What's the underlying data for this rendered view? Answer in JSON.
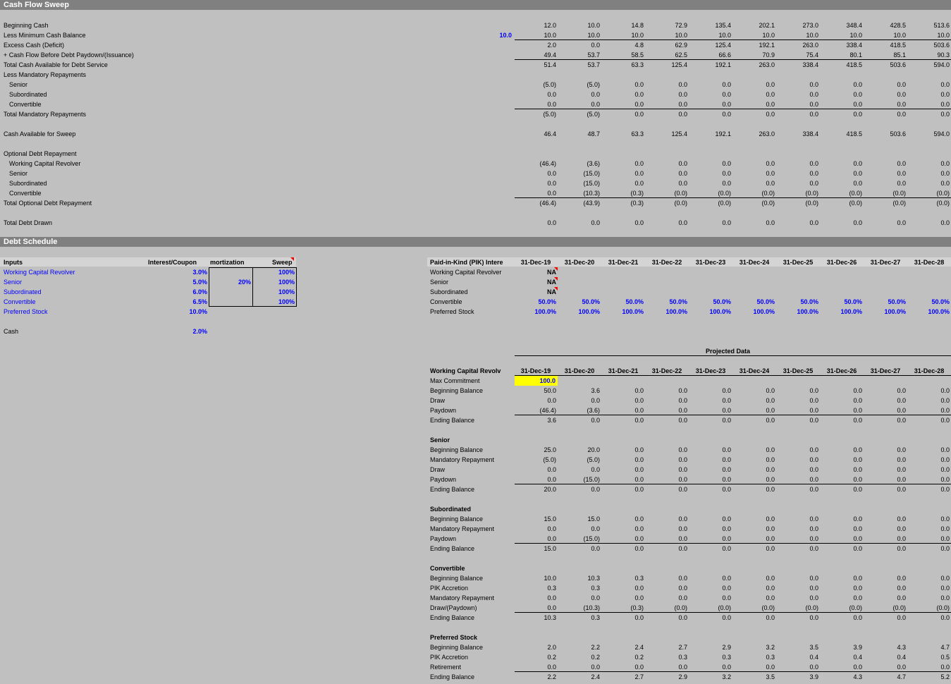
{
  "sections": {
    "cash_flow_sweep": "Cash Flow Sweep",
    "debt_schedule": "Debt Schedule"
  },
  "sweep": {
    "min_cash_input": "10.0",
    "rows": [
      {
        "label": "Beginning Cash",
        "indent": false,
        "v": [
          "12.0",
          "10.0",
          "14.8",
          "72.9",
          "135.4",
          "202.1",
          "273.0",
          "348.4",
          "428.5",
          "513.6"
        ]
      },
      {
        "label": "Less Minimum Cash Balance",
        "indent": false,
        "v": [
          "10.0",
          "10.0",
          "10.0",
          "10.0",
          "10.0",
          "10.0",
          "10.0",
          "10.0",
          "10.0",
          "10.0"
        ]
      },
      {
        "label": "Excess Cash (Deficit)",
        "indent": false,
        "v": [
          "2.0",
          "0.0",
          "4.8",
          "62.9",
          "125.4",
          "192.1",
          "263.0",
          "338.4",
          "418.5",
          "503.6"
        ]
      },
      {
        "label": "+ Cash Flow Before Debt Paydown/(Issuance)",
        "indent": false,
        "v": [
          "49.4",
          "53.7",
          "58.5",
          "62.5",
          "66.6",
          "70.9",
          "75.4",
          "80.1",
          "85.1",
          "90.3"
        ]
      },
      {
        "label": "Total Cash Available for Debt Service",
        "indent": false,
        "v": [
          "51.4",
          "53.7",
          "63.3",
          "125.4",
          "192.1",
          "263.0",
          "338.4",
          "418.5",
          "503.6",
          "594.0"
        ]
      },
      {
        "label": "Less Mandatory Repayments",
        "indent": false,
        "v": []
      },
      {
        "label": "Senior",
        "indent": true,
        "v": [
          "(5.0)",
          "(5.0)",
          "0.0",
          "0.0",
          "0.0",
          "0.0",
          "0.0",
          "0.0",
          "0.0",
          "0.0"
        ]
      },
      {
        "label": "Subordinated",
        "indent": true,
        "v": [
          "0.0",
          "0.0",
          "0.0",
          "0.0",
          "0.0",
          "0.0",
          "0.0",
          "0.0",
          "0.0",
          "0.0"
        ]
      },
      {
        "label": "Convertible",
        "indent": true,
        "v": [
          "0.0",
          "0.0",
          "0.0",
          "0.0",
          "0.0",
          "0.0",
          "0.0",
          "0.0",
          "0.0",
          "0.0"
        ]
      },
      {
        "label": "Total Mandatory Repayments",
        "indent": false,
        "v": [
          "(5.0)",
          "(5.0)",
          "0.0",
          "0.0",
          "0.0",
          "0.0",
          "0.0",
          "0.0",
          "0.0",
          "0.0"
        ]
      },
      {
        "label": "Cash Available for Sweep",
        "indent": false,
        "v": [
          "46.4",
          "48.7",
          "63.3",
          "125.4",
          "192.1",
          "263.0",
          "338.4",
          "418.5",
          "503.6",
          "594.0"
        ]
      },
      {
        "label": "Optional Debt Repayment",
        "indent": false,
        "v": []
      },
      {
        "label": "Working Capital Revolver",
        "indent": true,
        "v": [
          "(46.4)",
          "(3.6)",
          "0.0",
          "0.0",
          "0.0",
          "0.0",
          "0.0",
          "0.0",
          "0.0",
          "0.0"
        ]
      },
      {
        "label": "Senior",
        "indent": true,
        "v": [
          "0.0",
          "(15.0)",
          "0.0",
          "0.0",
          "0.0",
          "0.0",
          "0.0",
          "0.0",
          "0.0",
          "0.0"
        ]
      },
      {
        "label": "Subordinated",
        "indent": true,
        "v": [
          "0.0",
          "(15.0)",
          "0.0",
          "0.0",
          "0.0",
          "0.0",
          "0.0",
          "0.0",
          "0.0",
          "0.0"
        ]
      },
      {
        "label": "Convertible",
        "indent": true,
        "v": [
          "0.0",
          "(10.3)",
          "(0.3)",
          "(0.0)",
          "(0.0)",
          "(0.0)",
          "(0.0)",
          "(0.0)",
          "(0.0)",
          "(0.0)"
        ]
      },
      {
        "label": "Total Optional Debt Repayment",
        "indent": false,
        "v": [
          "(46.4)",
          "(43.9)",
          "(0.3)",
          "(0.0)",
          "(0.0)",
          "(0.0)",
          "(0.0)",
          "(0.0)",
          "(0.0)",
          "(0.0)"
        ]
      },
      {
        "label": "Total Debt Drawn",
        "indent": false,
        "v": [
          "0.0",
          "0.0",
          "0.0",
          "0.0",
          "0.0",
          "0.0",
          "0.0",
          "0.0",
          "0.0",
          "0.0"
        ]
      }
    ]
  },
  "inputs": {
    "headers": {
      "inputs": "Inputs",
      "interest": "Interest/Coupon",
      "amort": "mortization",
      "sweep": "Sweep"
    },
    "rows": [
      {
        "label": "Working Capital Revolver",
        "rate": "3.0%",
        "amort": "",
        "sweep": "100%"
      },
      {
        "label": "Senior",
        "rate": "5.0%",
        "amort": "20%",
        "sweep": "100%"
      },
      {
        "label": "Subordinated",
        "rate": "6.0%",
        "amort": "",
        "sweep": "100%"
      },
      {
        "label": "Convertible",
        "rate": "6.5%",
        "amort": "",
        "sweep": "100%"
      },
      {
        "label": "Preferred Stock",
        "rate": "10.0%",
        "amort": "",
        "sweep": ""
      }
    ],
    "cash_label": "Cash",
    "cash_rate": "2.0%"
  },
  "dates": [
    "31-Dec-19",
    "31-Dec-20",
    "31-Dec-21",
    "31-Dec-22",
    "31-Dec-23",
    "31-Dec-24",
    "31-Dec-25",
    "31-Dec-26",
    "31-Dec-27",
    "31-Dec-28"
  ],
  "pik": {
    "title": "Paid-in-Kind (PIK) Intere",
    "rows": [
      {
        "label": "Working Capital Revolver",
        "v": [
          "NA"
        ]
      },
      {
        "label": "Senior",
        "v": [
          "NA"
        ]
      },
      {
        "label": "Subordinated",
        "v": [
          "NA"
        ]
      },
      {
        "label": "Convertible",
        "v": [
          "50.0%",
          "50.0%",
          "50.0%",
          "50.0%",
          "50.0%",
          "50.0%",
          "50.0%",
          "50.0%",
          "50.0%",
          "50.0%"
        ]
      },
      {
        "label": "Preferred Stock",
        "v": [
          "100.0%",
          "100.0%",
          "100.0%",
          "100.0%",
          "100.0%",
          "100.0%",
          "100.0%",
          "100.0%",
          "100.0%",
          "100.0%"
        ]
      }
    ]
  },
  "projected_label": "Projected Data",
  "wcr": {
    "title": "Working Capital Revolv",
    "max_label": "Max Commitment",
    "max_value": "100.0",
    "rows": [
      {
        "label": "Beginning Balance",
        "v": [
          "50.0",
          "3.6",
          "0.0",
          "0.0",
          "0.0",
          "0.0",
          "0.0",
          "0.0",
          "0.0",
          "0.0"
        ]
      },
      {
        "label": "Draw",
        "v": [
          "0.0",
          "0.0",
          "0.0",
          "0.0",
          "0.0",
          "0.0",
          "0.0",
          "0.0",
          "0.0",
          "0.0"
        ]
      },
      {
        "label": "Paydown",
        "v": [
          "(46.4)",
          "(3.6)",
          "0.0",
          "0.0",
          "0.0",
          "0.0",
          "0.0",
          "0.0",
          "0.0",
          "0.0"
        ]
      },
      {
        "label": "Ending Balance",
        "v": [
          "3.6",
          "0.0",
          "0.0",
          "0.0",
          "0.0",
          "0.0",
          "0.0",
          "0.0",
          "0.0",
          "0.0"
        ]
      }
    ]
  },
  "senior": {
    "title": "Senior",
    "rows": [
      {
        "label": "Beginning Balance",
        "v": [
          "25.0",
          "20.0",
          "0.0",
          "0.0",
          "0.0",
          "0.0",
          "0.0",
          "0.0",
          "0.0",
          "0.0"
        ]
      },
      {
        "label": "Mandatory Repayment",
        "v": [
          "(5.0)",
          "(5.0)",
          "0.0",
          "0.0",
          "0.0",
          "0.0",
          "0.0",
          "0.0",
          "0.0",
          "0.0"
        ]
      },
      {
        "label": "Draw",
        "v": [
          "0.0",
          "0.0",
          "0.0",
          "0.0",
          "0.0",
          "0.0",
          "0.0",
          "0.0",
          "0.0",
          "0.0"
        ]
      },
      {
        "label": "Paydown",
        "v": [
          "0.0",
          "(15.0)",
          "0.0",
          "0.0",
          "0.0",
          "0.0",
          "0.0",
          "0.0",
          "0.0",
          "0.0"
        ]
      },
      {
        "label": "Ending Balance",
        "v": [
          "20.0",
          "0.0",
          "0.0",
          "0.0",
          "0.0",
          "0.0",
          "0.0",
          "0.0",
          "0.0",
          "0.0"
        ]
      }
    ]
  },
  "subordinated": {
    "title": "Subordinated",
    "rows": [
      {
        "label": "Beginning Balance",
        "v": [
          "15.0",
          "15.0",
          "0.0",
          "0.0",
          "0.0",
          "0.0",
          "0.0",
          "0.0",
          "0.0",
          "0.0"
        ]
      },
      {
        "label": "Mandatory Repayment",
        "v": [
          "0.0",
          "0.0",
          "0.0",
          "0.0",
          "0.0",
          "0.0",
          "0.0",
          "0.0",
          "0.0",
          "0.0"
        ]
      },
      {
        "label": "Paydown",
        "v": [
          "0.0",
          "(15.0)",
          "0.0",
          "0.0",
          "0.0",
          "0.0",
          "0.0",
          "0.0",
          "0.0",
          "0.0"
        ]
      },
      {
        "label": "Ending Balance",
        "v": [
          "15.0",
          "0.0",
          "0.0",
          "0.0",
          "0.0",
          "0.0",
          "0.0",
          "0.0",
          "0.0",
          "0.0"
        ]
      }
    ]
  },
  "convertible": {
    "title": "Convertible",
    "rows": [
      {
        "label": "Beginning Balance",
        "v": [
          "10.0",
          "10.3",
          "0.3",
          "0.0",
          "0.0",
          "0.0",
          "0.0",
          "0.0",
          "0.0",
          "0.0"
        ]
      },
      {
        "label": "PIK Accretion",
        "v": [
          "0.3",
          "0.3",
          "0.0",
          "0.0",
          "0.0",
          "0.0",
          "0.0",
          "0.0",
          "0.0",
          "0.0"
        ]
      },
      {
        "label": "Mandatory Repayment",
        "v": [
          "0.0",
          "0.0",
          "0.0",
          "0.0",
          "0.0",
          "0.0",
          "0.0",
          "0.0",
          "0.0",
          "0.0"
        ]
      },
      {
        "label": "Draw/(Paydown)",
        "v": [
          "0.0",
          "(10.3)",
          "(0.3)",
          "(0.0)",
          "(0.0)",
          "(0.0)",
          "(0.0)",
          "(0.0)",
          "(0.0)",
          "(0.0)"
        ]
      },
      {
        "label": "Ending Balance",
        "v": [
          "10.3",
          "0.3",
          "0.0",
          "0.0",
          "0.0",
          "0.0",
          "0.0",
          "0.0",
          "0.0",
          "0.0"
        ]
      }
    ]
  },
  "preferred": {
    "title": "Preferred Stock",
    "rows": [
      {
        "label": "Beginning Balance",
        "v": [
          "2.0",
          "2.2",
          "2.4",
          "2.7",
          "2.9",
          "3.2",
          "3.5",
          "3.9",
          "4.3",
          "4.7"
        ]
      },
      {
        "label": "PIK Accretion",
        "v": [
          "0.2",
          "0.2",
          "0.2",
          "0.3",
          "0.3",
          "0.3",
          "0.4",
          "0.4",
          "0.4",
          "0.5"
        ]
      },
      {
        "label": "Retirement",
        "v": [
          "0.0",
          "0.0",
          "0.0",
          "0.0",
          "0.0",
          "0.0",
          "0.0",
          "0.0",
          "0.0",
          "0.0"
        ]
      },
      {
        "label": "Ending Balance",
        "v": [
          "2.2",
          "2.4",
          "2.7",
          "2.9",
          "3.2",
          "3.5",
          "3.9",
          "4.3",
          "4.7",
          "5.2"
        ]
      }
    ]
  }
}
